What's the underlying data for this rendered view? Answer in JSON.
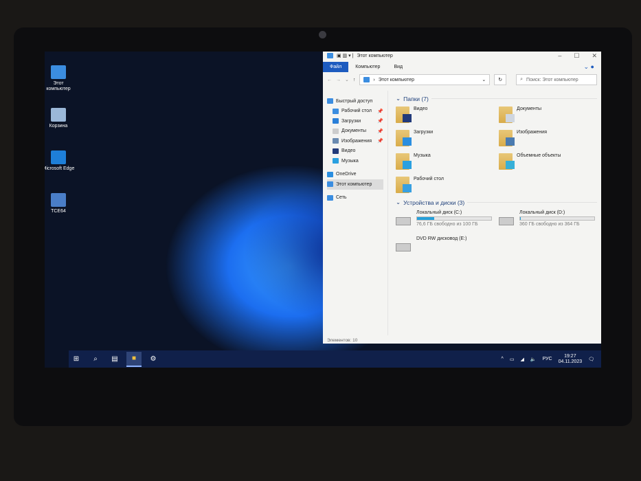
{
  "desktop": {
    "icons": [
      {
        "label": "Этот компьютер",
        "color": "#3b8de0"
      },
      {
        "label": "Корзина",
        "color": "#9bb8d8"
      },
      {
        "label": "Microsoft Edge",
        "color": "#1e7fd8"
      },
      {
        "label": "TCE64",
        "color": "#4a7ec8"
      }
    ]
  },
  "explorer": {
    "title": "Этот компьютер",
    "ribbon": [
      "Файл",
      "Компьютер",
      "Вид"
    ],
    "address": "Этот компьютер",
    "search_placeholder": "Поиск: Этот компьютер",
    "nav": [
      {
        "label": "Быстрый доступ"
      },
      {
        "label": "Рабочий стол",
        "pinned": true
      },
      {
        "label": "Загрузки",
        "pinned": true
      },
      {
        "label": "Документы",
        "pinned": true
      },
      {
        "label": "Изображения",
        "pinned": true
      },
      {
        "label": "Видео"
      },
      {
        "label": "Музыка"
      },
      {
        "label": "OneDrive"
      },
      {
        "label": "Этот компьютер",
        "selected": true
      },
      {
        "label": "Сеть"
      }
    ],
    "folders_header": "Папки (7)",
    "folders": [
      {
        "label": "Видео",
        "c": "#223a7a"
      },
      {
        "label": "Документы",
        "c": "#cfd6e0"
      },
      {
        "label": "Загрузки",
        "c": "#2a8ee0"
      },
      {
        "label": "Изображения",
        "c": "#4b7bb0"
      },
      {
        "label": "Музыка",
        "c": "#2aa0e0"
      },
      {
        "label": "Объемные объекты",
        "c": "#37b0d8"
      },
      {
        "label": "Рабочий стол",
        "c": "#38a0e0"
      }
    ],
    "drives_header": "Устройства и диски (3)",
    "drives": [
      {
        "label": "Локальный диск (C:)",
        "free": "76,6 ГБ свободно из 100 ГБ",
        "used_percent": 23.4
      },
      {
        "label": "Локальный диск (D:)",
        "free": "360 ГБ свободно из 364 ГБ",
        "used_percent": 1.1
      },
      {
        "label": "DVD RW дисковод (E:)"
      }
    ],
    "status": "Элементов: 10"
  },
  "taskbar": {
    "lang": "РУС",
    "time": "19:27",
    "date": "04.11.2023"
  }
}
